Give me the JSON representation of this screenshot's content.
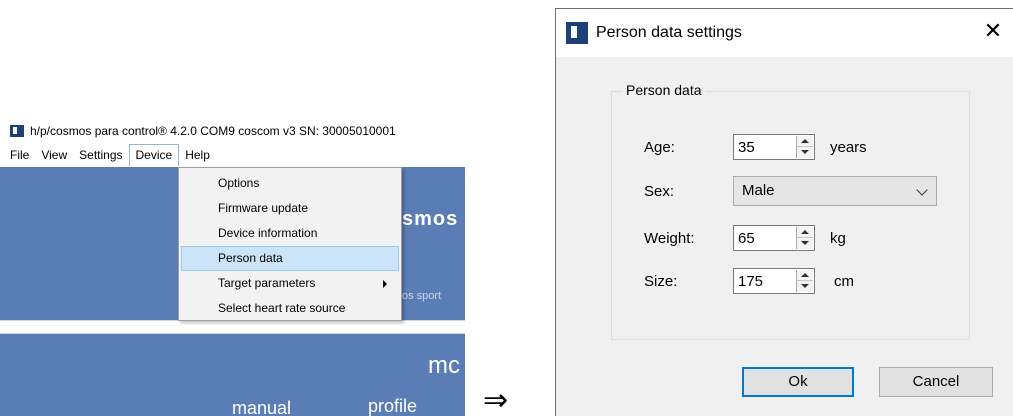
{
  "app": {
    "title": "h/p/cosmos para control® 4.2.0 COM9 coscom v3  SN: 30005010001",
    "menu": [
      "File",
      "View",
      "Settings",
      "Device",
      "Help"
    ],
    "logo_fragment": "smos",
    "sport_fragment": "os sport",
    "mo_fragment": "mc",
    "manual_label": "manual",
    "profile_label": "profile"
  },
  "device_menu": {
    "items": [
      {
        "label": "Options"
      },
      {
        "label": "Firmware update"
      },
      {
        "label": "Device information"
      },
      {
        "label": "Person data",
        "highlighted": true
      },
      {
        "label": "Target parameters",
        "submenu": true
      },
      {
        "label": "Select heart rate source"
      }
    ]
  },
  "arrow_glyph": "⇒",
  "dialog": {
    "title": "Person data settings",
    "close_glyph": "✕",
    "group_label": "Person data",
    "age": {
      "label": "Age:",
      "value": "35",
      "unit": "years"
    },
    "sex": {
      "label": "Sex:",
      "value": "Male"
    },
    "weight": {
      "label": "Weight:",
      "value": "65",
      "unit": "kg"
    },
    "size": {
      "label": "Size:",
      "value": "175",
      "unit": "cm"
    },
    "ok_label": "Ok",
    "cancel_label": "Cancel"
  },
  "colors": {
    "app_blue": "#5b7db5",
    "menu_highlight": "#cce4f7",
    "default_button_border": "#0078d7"
  }
}
